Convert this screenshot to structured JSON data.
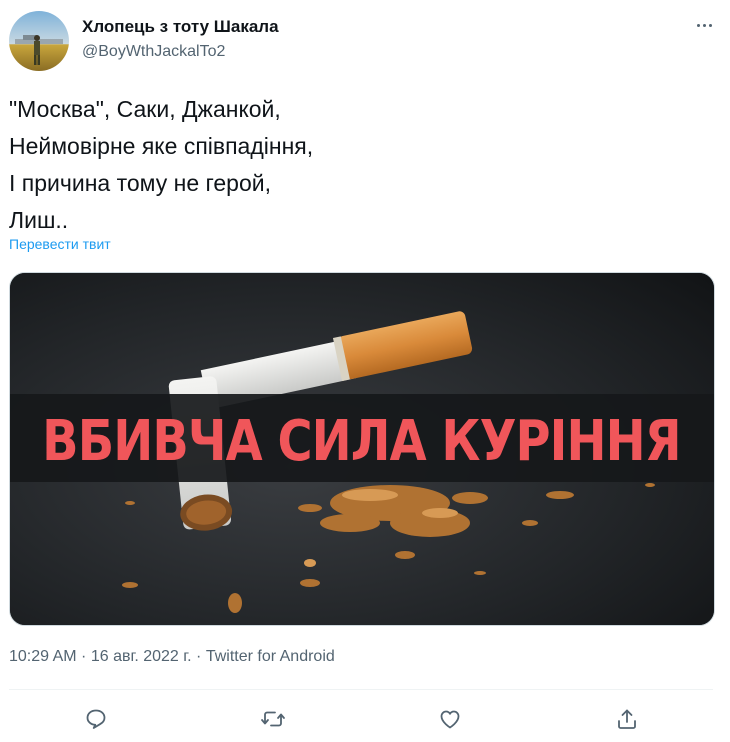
{
  "tweet": {
    "display_name": "Хлопець з тоту Шакала",
    "handle": "@BoyWthJackalTo2",
    "text_lines": [
      "\"Москва\", Саки, Джанкой,",
      "Неймовірне яке співпадіння,",
      "І причина тому не герой,",
      "Лиш.."
    ],
    "translate_label": "Перевести твит",
    "timestamp": "10:29 AM · 16 авг. 2022 г. · Twitter for Android"
  },
  "media": {
    "banner_text": "ВБИВЧА СИЛА КУРІННЯ",
    "banner_color": "#f0565a"
  },
  "actions": {
    "icons": [
      "reply-icon",
      "retweet-icon",
      "like-icon",
      "share-icon"
    ]
  },
  "colors": {
    "link": "#1d9bf0",
    "secondary_text": "#536471",
    "primary_text": "#0f1419"
  }
}
